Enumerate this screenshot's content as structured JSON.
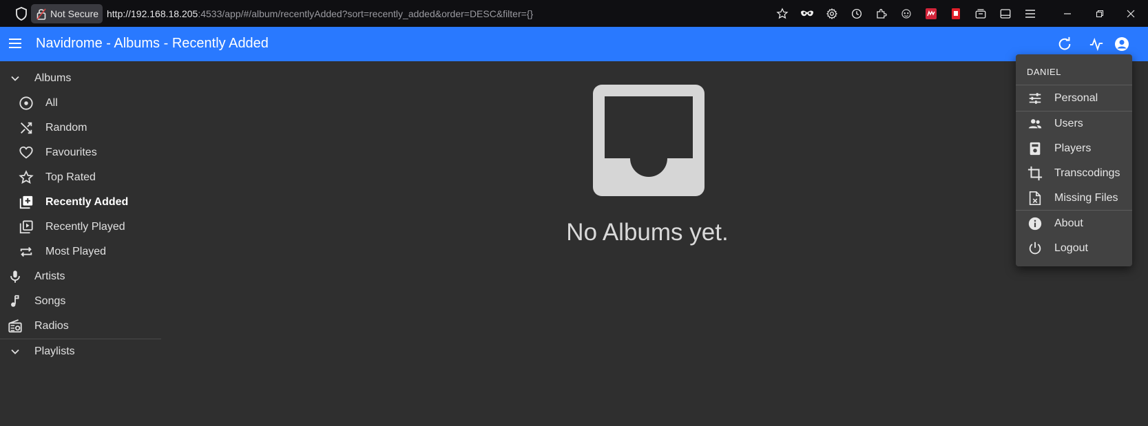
{
  "browser": {
    "security_label": "Not Secure",
    "url_host": "http://192.168.18.205",
    "url_rest": ":4533/app/#/album/recentlyAdded?sort=recently_added&order=DESC&filter={}",
    "toolbar_icons": [
      "star-icon",
      "incognito-icon",
      "gear-icon",
      "history-icon",
      "extension-icon",
      "tampermonkey-icon",
      "ublock-icon",
      "pdf-icon",
      "tab-container-icon",
      "sidebar-icon",
      "menu-icon"
    ],
    "window_controls": [
      "minimize-icon",
      "restore-icon",
      "close-icon"
    ]
  },
  "appbar": {
    "title": "Navidrome - Albums - Recently Added",
    "color": "#2979ff"
  },
  "sidebar": {
    "albums_label": "Albums",
    "items": [
      {
        "label": "All",
        "icon": "album-disc-icon"
      },
      {
        "label": "Random",
        "icon": "shuffle-icon"
      },
      {
        "label": "Favourites",
        "icon": "heart-icon"
      },
      {
        "label": "Top Rated",
        "icon": "star-icon"
      },
      {
        "label": "Recently Added",
        "icon": "library-add-icon",
        "active": true
      },
      {
        "label": "Recently Played",
        "icon": "video-library-icon"
      },
      {
        "label": "Most Played",
        "icon": "repeat-icon"
      }
    ],
    "artists_label": "Artists",
    "songs_label": "Songs",
    "radios_label": "Radios",
    "playlists_label": "Playlists"
  },
  "main": {
    "empty_message": "No Albums yet."
  },
  "user_menu": {
    "username": "DANIEL",
    "items": [
      {
        "label": "Personal",
        "icon": "tune-icon"
      },
      {
        "label": "Users",
        "icon": "people-icon"
      },
      {
        "label": "Players",
        "icon": "speaker-icon"
      },
      {
        "label": "Transcodings",
        "icon": "crop-icon"
      },
      {
        "label": "Missing Files",
        "icon": "file-x-icon"
      },
      {
        "label": "About",
        "icon": "info-icon"
      },
      {
        "label": "Logout",
        "icon": "power-icon"
      }
    ]
  }
}
